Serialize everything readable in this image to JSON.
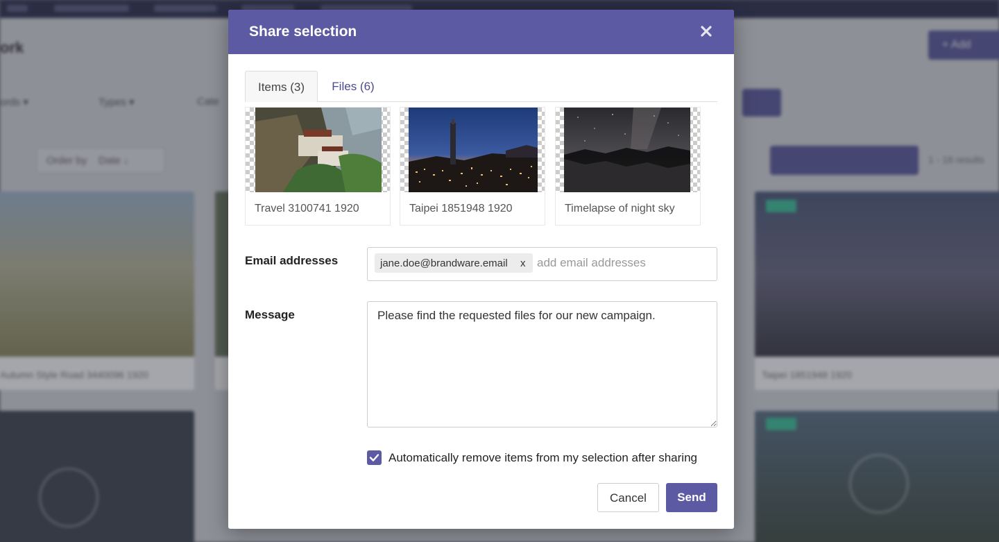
{
  "background": {
    "page_title": "ork",
    "add_button": "+ Add",
    "filters": [
      "ords ▾",
      "Types ▾",
      "Cate"
    ],
    "order_by_label": "Order by",
    "order_by_value": "Date ↓",
    "results_text": "1 - 18 results",
    "cards": [
      {
        "caption": "Autumn Style Road 3440096 1920"
      },
      {
        "caption": "Taipei 1851948 1920"
      }
    ]
  },
  "modal": {
    "title": "Share selection",
    "close_icon": "close-icon",
    "tabs": [
      {
        "label": "Items (3)",
        "active": true
      },
      {
        "label": "Files (6)",
        "active": false
      }
    ],
    "items": [
      {
        "label": "Travel 3100741 1920",
        "image": "mountain-monastery"
      },
      {
        "label": "Taipei 1851948 1920",
        "image": "city-night-skyline"
      },
      {
        "label": "Timelapse of night sky",
        "image": "starry-lake"
      }
    ],
    "email_label": "Email addresses",
    "email_tags": [
      {
        "value": "jane.doe@brandware.email",
        "remove": "x"
      }
    ],
    "email_placeholder": "add email addresses",
    "message_label": "Message",
    "message_value": "Please find the requested files for our new campaign.",
    "auto_remove_label": "Automatically remove items from my selection after sharing",
    "auto_remove_checked": true,
    "cancel_label": "Cancel",
    "send_label": "Send"
  },
  "colors": {
    "accent": "#5d5aa4",
    "topnav": "#2e3050",
    "badge": "#3ec39b"
  }
}
